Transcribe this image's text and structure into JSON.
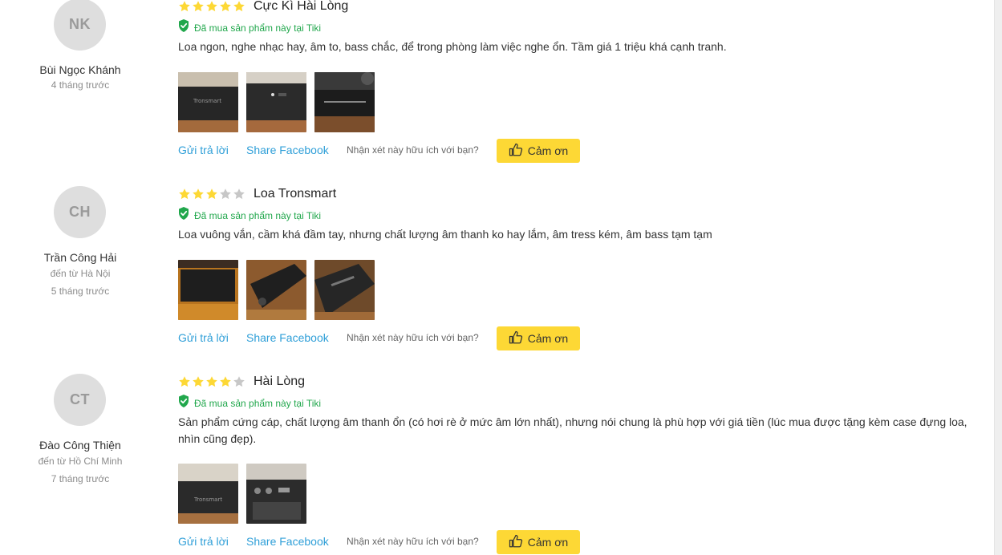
{
  "reviews": [
    {
      "initials": "NK",
      "name": "Bùi Ngọc Khánh",
      "location": "",
      "time": "4 tháng trước",
      "rating": 5,
      "title": "Cực Kì Hài Lòng",
      "verified": "Đã mua sản phẩm này tại Tiki",
      "text": "Loa ngon, nghe nhạc hay, âm to, bass chắc, để trong phòng làm việc nghe ổn. Tầm giá 1 triệu khá cạnh tranh.",
      "photo_labels": [
        "Tronsmart",
        "",
        ""
      ],
      "reply": "Gửi trả lời",
      "share": "Share Facebook",
      "helpful": "Nhận xét này hữu ích với bạn?",
      "thanks": "Cảm ơn"
    },
    {
      "initials": "CH",
      "name": "Trần Công Hải",
      "location": "đến từ Hà Nội",
      "time": "5 tháng trước",
      "rating": 3,
      "title": "Loa Tronsmart",
      "verified": "Đã mua sản phẩm này tại Tiki",
      "text": "Loa vuông vắn, cầm khá đầm tay, nhưng chất lượng âm thanh ko hay lắm, âm tress kém, âm bass tạm tạm",
      "photo_labels": [
        "",
        "",
        ""
      ],
      "reply": "Gửi trả lời",
      "share": "Share Facebook",
      "helpful": "Nhận xét này hữu ích với bạn?",
      "thanks": "Cảm ơn"
    },
    {
      "initials": "CT",
      "name": "Đào Công Thiện",
      "location": "đến từ Hồ Chí Minh",
      "time": "7 tháng trước",
      "rating": 4,
      "title": "Hài Lòng",
      "verified": "Đã mua sản phẩm này tại Tiki",
      "text": "Sản phẩm cứng cáp, chất lượng âm thanh ổn (có hơi rè ở mức âm lớn nhất), nhưng nói chung là phù hợp với giá tiền (lúc mua được tặng kèm case đựng loa, nhìn cũng đẹp).",
      "photo_labels": [
        "Tronsmart",
        ""
      ],
      "reply": "Gửi trả lời",
      "share": "Share Facebook",
      "helpful": "Nhận xét này hữu ích với bạn?",
      "thanks": "Cảm ơn"
    }
  ],
  "colors": {
    "star_filled": "#fdd835",
    "star_empty": "#c7c7c7",
    "verified_green": "#21a74c",
    "link_blue": "#2f9fd8",
    "thanks_yellow": "#fdd835"
  },
  "icons": {
    "star": "star-icon",
    "verified": "shield-check-icon",
    "thanks": "thumbs-up-icon"
  }
}
